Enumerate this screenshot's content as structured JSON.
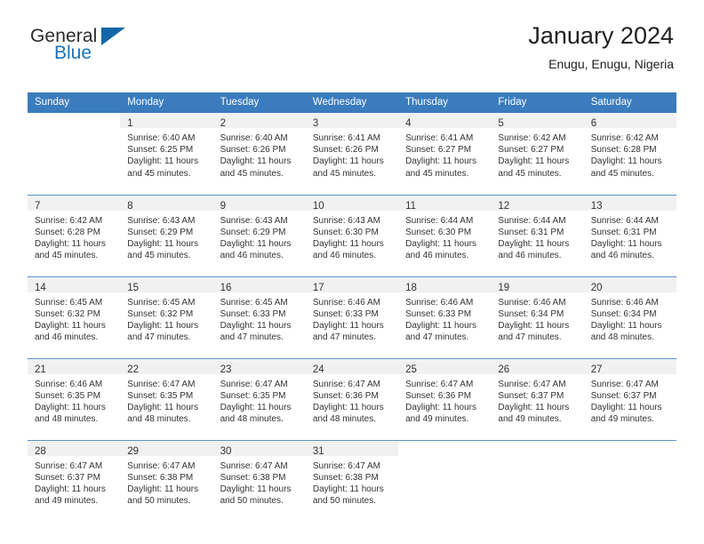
{
  "brand": {
    "name_top": "General",
    "name_bottom": "Blue",
    "accent_color": "#1b72b8"
  },
  "header": {
    "title": "January 2024",
    "subtitle": "Enugu, Enugu, Nigeria"
  },
  "calendar": {
    "header_bg": "#3a7cbe",
    "weekday_headers": [
      "Sunday",
      "Monday",
      "Tuesday",
      "Wednesday",
      "Thursday",
      "Friday",
      "Saturday"
    ],
    "weeks": [
      [
        {
          "day": "",
          "sunrise": "",
          "sunset": "",
          "daylight_line1": "",
          "daylight_line2": ""
        },
        {
          "day": "1",
          "sunrise": "Sunrise: 6:40 AM",
          "sunset": "Sunset: 6:25 PM",
          "daylight_line1": "Daylight: 11 hours",
          "daylight_line2": "and 45 minutes."
        },
        {
          "day": "2",
          "sunrise": "Sunrise: 6:40 AM",
          "sunset": "Sunset: 6:26 PM",
          "daylight_line1": "Daylight: 11 hours",
          "daylight_line2": "and 45 minutes."
        },
        {
          "day": "3",
          "sunrise": "Sunrise: 6:41 AM",
          "sunset": "Sunset: 6:26 PM",
          "daylight_line1": "Daylight: 11 hours",
          "daylight_line2": "and 45 minutes."
        },
        {
          "day": "4",
          "sunrise": "Sunrise: 6:41 AM",
          "sunset": "Sunset: 6:27 PM",
          "daylight_line1": "Daylight: 11 hours",
          "daylight_line2": "and 45 minutes."
        },
        {
          "day": "5",
          "sunrise": "Sunrise: 6:42 AM",
          "sunset": "Sunset: 6:27 PM",
          "daylight_line1": "Daylight: 11 hours",
          "daylight_line2": "and 45 minutes."
        },
        {
          "day": "6",
          "sunrise": "Sunrise: 6:42 AM",
          "sunset": "Sunset: 6:28 PM",
          "daylight_line1": "Daylight: 11 hours",
          "daylight_line2": "and 45 minutes."
        }
      ],
      [
        {
          "day": "7",
          "sunrise": "Sunrise: 6:42 AM",
          "sunset": "Sunset: 6:28 PM",
          "daylight_line1": "Daylight: 11 hours",
          "daylight_line2": "and 45 minutes."
        },
        {
          "day": "8",
          "sunrise": "Sunrise: 6:43 AM",
          "sunset": "Sunset: 6:29 PM",
          "daylight_line1": "Daylight: 11 hours",
          "daylight_line2": "and 45 minutes."
        },
        {
          "day": "9",
          "sunrise": "Sunrise: 6:43 AM",
          "sunset": "Sunset: 6:29 PM",
          "daylight_line1": "Daylight: 11 hours",
          "daylight_line2": "and 46 minutes."
        },
        {
          "day": "10",
          "sunrise": "Sunrise: 6:43 AM",
          "sunset": "Sunset: 6:30 PM",
          "daylight_line1": "Daylight: 11 hours",
          "daylight_line2": "and 46 minutes."
        },
        {
          "day": "11",
          "sunrise": "Sunrise: 6:44 AM",
          "sunset": "Sunset: 6:30 PM",
          "daylight_line1": "Daylight: 11 hours",
          "daylight_line2": "and 46 minutes."
        },
        {
          "day": "12",
          "sunrise": "Sunrise: 6:44 AM",
          "sunset": "Sunset: 6:31 PM",
          "daylight_line1": "Daylight: 11 hours",
          "daylight_line2": "and 46 minutes."
        },
        {
          "day": "13",
          "sunrise": "Sunrise: 6:44 AM",
          "sunset": "Sunset: 6:31 PM",
          "daylight_line1": "Daylight: 11 hours",
          "daylight_line2": "and 46 minutes."
        }
      ],
      [
        {
          "day": "14",
          "sunrise": "Sunrise: 6:45 AM",
          "sunset": "Sunset: 6:32 PM",
          "daylight_line1": "Daylight: 11 hours",
          "daylight_line2": "and 46 minutes."
        },
        {
          "day": "15",
          "sunrise": "Sunrise: 6:45 AM",
          "sunset": "Sunset: 6:32 PM",
          "daylight_line1": "Daylight: 11 hours",
          "daylight_line2": "and 47 minutes."
        },
        {
          "day": "16",
          "sunrise": "Sunrise: 6:45 AM",
          "sunset": "Sunset: 6:33 PM",
          "daylight_line1": "Daylight: 11 hours",
          "daylight_line2": "and 47 minutes."
        },
        {
          "day": "17",
          "sunrise": "Sunrise: 6:46 AM",
          "sunset": "Sunset: 6:33 PM",
          "daylight_line1": "Daylight: 11 hours",
          "daylight_line2": "and 47 minutes."
        },
        {
          "day": "18",
          "sunrise": "Sunrise: 6:46 AM",
          "sunset": "Sunset: 6:33 PM",
          "daylight_line1": "Daylight: 11 hours",
          "daylight_line2": "and 47 minutes."
        },
        {
          "day": "19",
          "sunrise": "Sunrise: 6:46 AM",
          "sunset": "Sunset: 6:34 PM",
          "daylight_line1": "Daylight: 11 hours",
          "daylight_line2": "and 47 minutes."
        },
        {
          "day": "20",
          "sunrise": "Sunrise: 6:46 AM",
          "sunset": "Sunset: 6:34 PM",
          "daylight_line1": "Daylight: 11 hours",
          "daylight_line2": "and 48 minutes."
        }
      ],
      [
        {
          "day": "21",
          "sunrise": "Sunrise: 6:46 AM",
          "sunset": "Sunset: 6:35 PM",
          "daylight_line1": "Daylight: 11 hours",
          "daylight_line2": "and 48 minutes."
        },
        {
          "day": "22",
          "sunrise": "Sunrise: 6:47 AM",
          "sunset": "Sunset: 6:35 PM",
          "daylight_line1": "Daylight: 11 hours",
          "daylight_line2": "and 48 minutes."
        },
        {
          "day": "23",
          "sunrise": "Sunrise: 6:47 AM",
          "sunset": "Sunset: 6:35 PM",
          "daylight_line1": "Daylight: 11 hours",
          "daylight_line2": "and 48 minutes."
        },
        {
          "day": "24",
          "sunrise": "Sunrise: 6:47 AM",
          "sunset": "Sunset: 6:36 PM",
          "daylight_line1": "Daylight: 11 hours",
          "daylight_line2": "and 48 minutes."
        },
        {
          "day": "25",
          "sunrise": "Sunrise: 6:47 AM",
          "sunset": "Sunset: 6:36 PM",
          "daylight_line1": "Daylight: 11 hours",
          "daylight_line2": "and 49 minutes."
        },
        {
          "day": "26",
          "sunrise": "Sunrise: 6:47 AM",
          "sunset": "Sunset: 6:37 PM",
          "daylight_line1": "Daylight: 11 hours",
          "daylight_line2": "and 49 minutes."
        },
        {
          "day": "27",
          "sunrise": "Sunrise: 6:47 AM",
          "sunset": "Sunset: 6:37 PM",
          "daylight_line1": "Daylight: 11 hours",
          "daylight_line2": "and 49 minutes."
        }
      ],
      [
        {
          "day": "28",
          "sunrise": "Sunrise: 6:47 AM",
          "sunset": "Sunset: 6:37 PM",
          "daylight_line1": "Daylight: 11 hours",
          "daylight_line2": "and 49 minutes."
        },
        {
          "day": "29",
          "sunrise": "Sunrise: 6:47 AM",
          "sunset": "Sunset: 6:38 PM",
          "daylight_line1": "Daylight: 11 hours",
          "daylight_line2": "and 50 minutes."
        },
        {
          "day": "30",
          "sunrise": "Sunrise: 6:47 AM",
          "sunset": "Sunset: 6:38 PM",
          "daylight_line1": "Daylight: 11 hours",
          "daylight_line2": "and 50 minutes."
        },
        {
          "day": "31",
          "sunrise": "Sunrise: 6:47 AM",
          "sunset": "Sunset: 6:38 PM",
          "daylight_line1": "Daylight: 11 hours",
          "daylight_line2": "and 50 minutes."
        },
        {
          "day": "",
          "sunrise": "",
          "sunset": "",
          "daylight_line1": "",
          "daylight_line2": ""
        },
        {
          "day": "",
          "sunrise": "",
          "sunset": "",
          "daylight_line1": "",
          "daylight_line2": ""
        },
        {
          "day": "",
          "sunrise": "",
          "sunset": "",
          "daylight_line1": "",
          "daylight_line2": ""
        }
      ]
    ]
  }
}
